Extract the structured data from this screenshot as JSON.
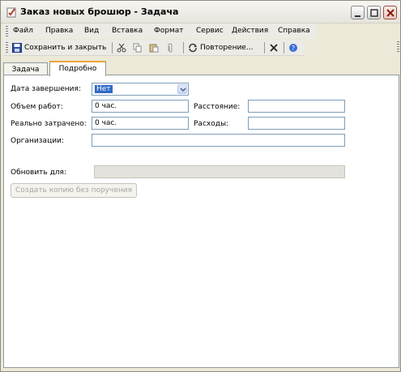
{
  "window": {
    "title": "Заказ новых брошюр - Задача"
  },
  "menu": [
    "Файл",
    "Правка",
    "Вид",
    "Вставка",
    "Формат",
    "Сервис",
    "Действия",
    "Справка"
  ],
  "toolbar": {
    "save_close": "Сохранить и закрыть",
    "recurrence": "Повторение..."
  },
  "tabs": {
    "task": "Задача",
    "details": "Подробно"
  },
  "form": {
    "due_date_label": "Дата завершения:",
    "due_date_value": "Нет",
    "work_label": "Объем работ:",
    "work_value": "0 час.",
    "distance_label": "Расстояние:",
    "distance_value": "",
    "actual_label": "Реально затрачено:",
    "actual_value": "0 час.",
    "expenses_label": "Расходы:",
    "expenses_value": "",
    "companies_label": "Организации:",
    "companies_value": "",
    "update_label": "Обновить для:",
    "update_value": "",
    "create_copy_button": "Создать копию без поручения"
  }
}
